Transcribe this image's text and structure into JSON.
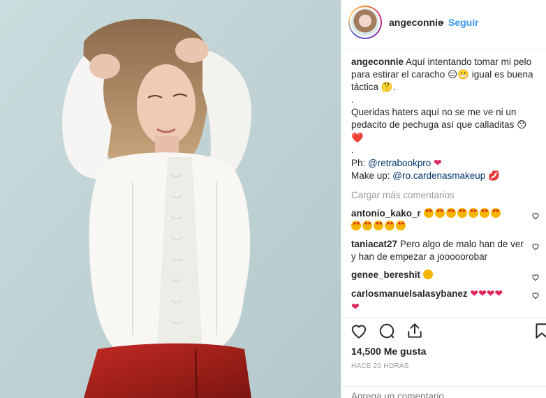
{
  "post": {
    "username": "angeconnie",
    "separator": "•",
    "follow_label": "Seguir",
    "caption_lines": [
      "Aquí intentando tomar mi pelo para estirar el caracho 😑😬 igual es buena táctica 🤔.",
      ".",
      "Queridas haters aquí no se me ve ni un pedacito de pechuga así que calladitas 😯",
      "❤️",
      "."
    ],
    "credit_ph_label": "Ph:",
    "credit_ph_handle": "@retrabookpro",
    "credit_makeup_label": "Make up:",
    "credit_makeup_handle": "@ro.cardenasmakeup",
    "load_more": "Cargar más comentarios",
    "likes": "14,500 Me gusta",
    "time_ago": "HACE 20 HORAS",
    "comment_placeholder": "Agrega un comentario..."
  },
  "comments": [
    {
      "user": "antonio_kako_r",
      "text": ""
    },
    {
      "user": "taniacat27",
      "text": "Pero algo de malo han de ver y han de empezar a jooooorobar"
    },
    {
      "user": "genee_bereshit",
      "text": ""
    },
    {
      "user": "carlosmanuelsalasybanez",
      "text": ""
    }
  ],
  "icons": [
    "heart-icon",
    "comment-icon",
    "share-icon",
    "bookmark-icon"
  ],
  "colors": {
    "link": "#3897f0",
    "heart": "#e0245e",
    "muted": "#999999"
  }
}
